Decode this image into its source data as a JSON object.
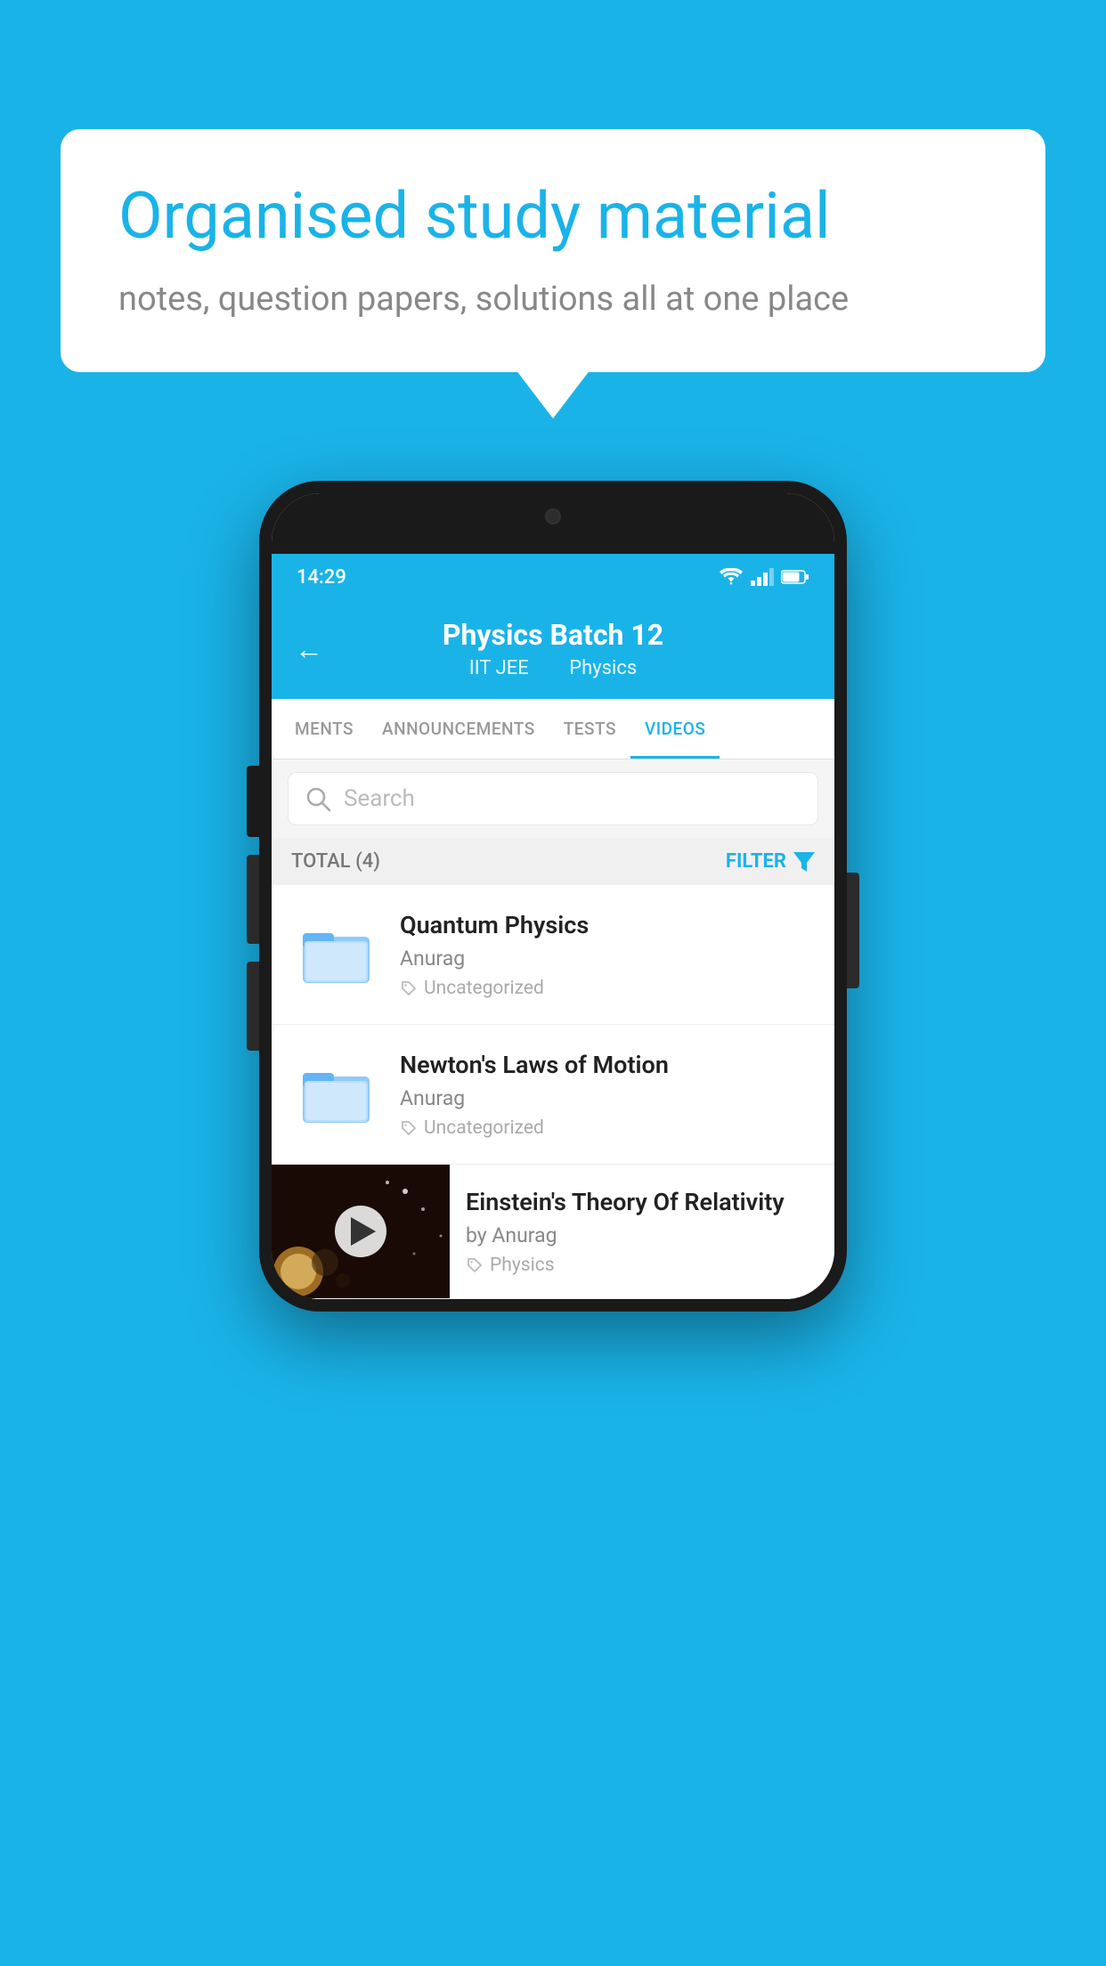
{
  "background_color": "#1ab3e8",
  "speech_bubble": {
    "heading": "Organised study material",
    "subtext": "notes, question papers, solutions all at one place"
  },
  "status_bar": {
    "time": "14:29",
    "wifi_icon": "wifi-icon",
    "signal_icon": "signal-icon",
    "battery_icon": "battery-icon"
  },
  "header": {
    "back_label": "←",
    "title": "Physics Batch 12",
    "subtitle_part1": "IIT JEE",
    "subtitle_part2": "Physics"
  },
  "tabs": [
    {
      "label": "MENTS",
      "active": false
    },
    {
      "label": "ANNOUNCEMENTS",
      "active": false
    },
    {
      "label": "TESTS",
      "active": false
    },
    {
      "label": "VIDEOS",
      "active": true
    }
  ],
  "search": {
    "placeholder": "Search"
  },
  "filter_row": {
    "total_label": "TOTAL (4)",
    "filter_label": "FILTER"
  },
  "videos": [
    {
      "title": "Quantum Physics",
      "author": "Anurag",
      "tag": "Uncategorized",
      "has_thumbnail": false
    },
    {
      "title": "Newton's Laws of Motion",
      "author": "Anurag",
      "tag": "Uncategorized",
      "has_thumbnail": false
    },
    {
      "title": "Einstein's Theory Of Relativity",
      "author": "by Anurag",
      "tag": "Physics",
      "has_thumbnail": true
    }
  ]
}
